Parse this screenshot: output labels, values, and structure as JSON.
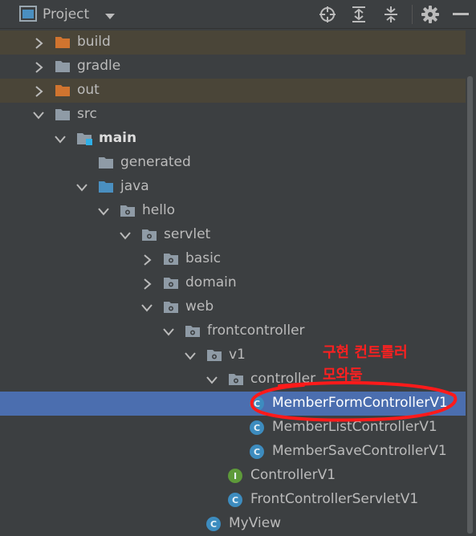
{
  "header": {
    "title": "Project",
    "icons": [
      "project-panel-icon",
      "chevron-down-icon",
      "locate-icon",
      "expand-all-icon",
      "collapse-all-icon",
      "gear-icon",
      "minimize-icon"
    ]
  },
  "tree": {
    "nodes": [
      {
        "label": "build",
        "type": "folder-excluded",
        "expanded": false
      },
      {
        "label": "gradle",
        "type": "folder",
        "expanded": false
      },
      {
        "label": "out",
        "type": "folder-excluded",
        "expanded": false
      },
      {
        "label": "src",
        "type": "folder",
        "expanded": true
      },
      {
        "label": "main",
        "type": "module-folder",
        "expanded": true
      },
      {
        "label": "generated",
        "type": "folder"
      },
      {
        "label": "java",
        "type": "source-folder",
        "expanded": true
      },
      {
        "label": "hello",
        "type": "package",
        "expanded": true
      },
      {
        "label": "servlet",
        "type": "package",
        "expanded": true
      },
      {
        "label": "basic",
        "type": "package",
        "expanded": false
      },
      {
        "label": "domain",
        "type": "package",
        "expanded": false
      },
      {
        "label": "web",
        "type": "package",
        "expanded": true
      },
      {
        "label": "frontcontroller",
        "type": "package",
        "expanded": true
      },
      {
        "label": "v1",
        "type": "package",
        "expanded": true
      },
      {
        "label": "controller",
        "type": "package",
        "expanded": true
      },
      {
        "label": "MemberFormControllerV1",
        "type": "class",
        "selected": true
      },
      {
        "label": "MemberListControllerV1",
        "type": "class"
      },
      {
        "label": "MemberSaveControllerV1",
        "type": "class"
      },
      {
        "label": "ControllerV1",
        "type": "interface"
      },
      {
        "label": "FrontControllerServletV1",
        "type": "class"
      },
      {
        "label": "MyView",
        "type": "class"
      }
    ]
  },
  "badges": {
    "class": "C",
    "interface": "I"
  },
  "annotation": {
    "line1": "구현 컨트롤러",
    "line2": "모와둠",
    "color": "#ff2020"
  },
  "colors": {
    "background": "#3c3f41",
    "selection": "#4b6eaf",
    "excluded_row": "#4a4538",
    "folder_excluded": "#d0742f",
    "folder": "#8f9ba6",
    "source_folder": "#4a8fc0",
    "class_badge": "#3d8cbf",
    "interface_badge": "#5e9a3a"
  }
}
